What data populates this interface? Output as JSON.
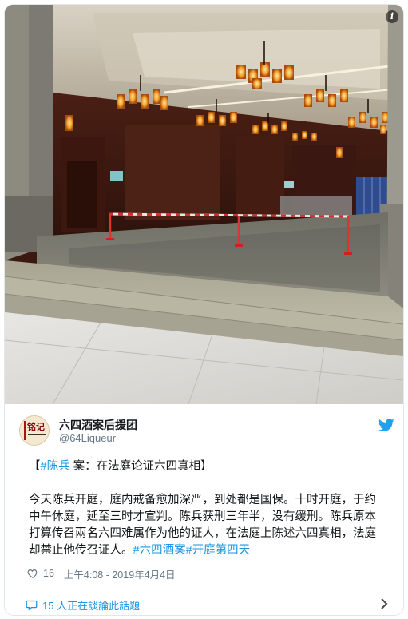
{
  "tweet": {
    "author_name": "六四酒案后援团",
    "handle": "@64Liqueur",
    "avatar_text": "铭记",
    "headline_prefix": "【",
    "headline_hashtag": "#陈兵",
    "headline_rest": " 案：在法庭论证六四真相】",
    "body_main": "今天陈兵开庭，庭内戒备愈加深严，到处都是国保。十时开庭，于约中午休庭，延至三时才宣判。陈兵获刑三年半，没有缓刑。陈兵原本打算传召兩名六四难属作为他的证人，在法庭上陈述六四真相，法庭却禁止他传召证人。",
    "hashtag_1": "#六四酒案",
    "hashtag_2": "#开庭第四天",
    "likes": "16",
    "timestamp": "上午4:08 - 2019年4月4日",
    "footer_text": "15 人正在談論此話題"
  },
  "icons": {
    "info": "info-icon",
    "twitter": "twitter-bird-icon",
    "like": "heart-icon",
    "reply": "speech-bubble-icon",
    "chevron": "chevron-right-icon"
  },
  "colors": {
    "link": "#1b95e0",
    "text": "#14171a",
    "muted": "#657786",
    "border": "#e1e8ed"
  }
}
